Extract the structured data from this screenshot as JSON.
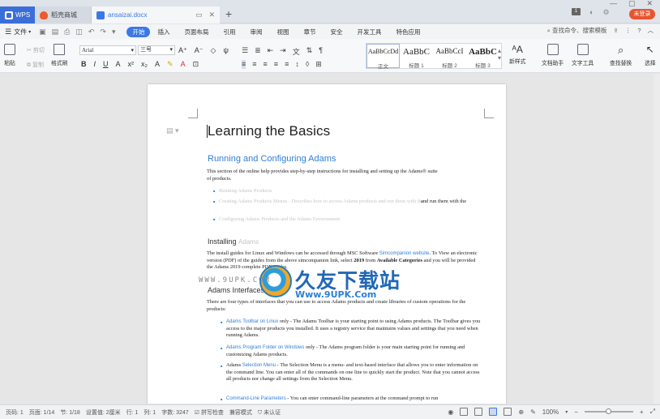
{
  "titlebar": {
    "app_tab": "WPS",
    "tabs": [
      {
        "label": "稻壳商城"
      },
      {
        "label": "ansaizai.docx"
      }
    ],
    "new_tab": "+",
    "login": "未登录"
  },
  "menubar": {
    "file": "文件",
    "tabs": [
      "开始",
      "插入",
      "页面布局",
      "引用",
      "审阅",
      "视图",
      "章节",
      "安全",
      "开发工具",
      "特色应用"
    ],
    "active_tab": "开始",
    "search": "查找命令、搜索模板"
  },
  "ribbon": {
    "paste": "粘贴",
    "cut": "剪切",
    "copy": "复制",
    "format_painter": "格式刷",
    "font_name": "Arial",
    "font_size": "三号",
    "styles": [
      {
        "sample": "AaBbCcDd",
        "name": "正文"
      },
      {
        "sample": "AaBbC",
        "name": "标题 1"
      },
      {
        "sample": "AaBbCcI",
        "name": "标题 2"
      },
      {
        "sample": "AaBbC",
        "name": "标题 3"
      }
    ],
    "new_style": "新样式",
    "doc_assistant": "文档助手",
    "text_tools": "文字工具",
    "find_replace": "查找替换",
    "select": "选择"
  },
  "document": {
    "title": "Learning the Basics",
    "heading2": "Running and Configuring  Adams",
    "p1_a": "This section of the online help provides step-by-step instructions for installing and setting up the Adams® suite",
    "p1_b": "of products.",
    "bullets_1": [
      "Running Adams Products",
      "Creating Adams Products Menus - Describes how to access Adams products and run them with the",
      "Configuring Adams Products and the Adams Environment"
    ],
    "b2_cont": "and run them with the",
    "installing_heading": "Installing",
    "installing_faint": "Adams",
    "installing_p": [
      "The install guides for Linux and Windows can be accessed through MSC Software ",
      "Simcompanion website",
      ". To View an electronic version (PDF) of the guides from the above simcompanion link, select ",
      "2019",
      " from ",
      "Available Categories",
      " and you will be provided the Adams 2019 complete PDF guides."
    ],
    "interfaces_heading": "Adams  Interfaces",
    "interfaces_p": "There are four types of interfaces that you can use to access Adams products and create libraries of custom operations for the products:",
    "interfaces_bullets": [
      {
        "link": "Adams Toolbar on Linux",
        "text": " only - The Adams Toolbar is your starting point to using Adams products. The Toolbar gives you access to the major products you installed. It uses a registry service that maintains values and settings that you need when running Adams."
      },
      {
        "link": "Adams Program Folder on Windows",
        "text": " only - The Adams program folder is your main starting point for running and customizing Adams products."
      },
      {
        "prefix": "Adams ",
        "link": "Selection Menu",
        "text": " - The Selection Menu is a menu- and text-based interface that allows you to enter information on the command line. You can enter all of the commands on one line to quickly start the product. Note that you cannot access all products nor change all settings from the Selection Menu."
      },
      {
        "link": "Command-Line Parameters",
        "text": " - You can enter command-line parameters at the command prompt to run"
      }
    ],
    "watermark_title": "久友下载站",
    "watermark_url": "Www.9UPK.Com",
    "watermark_url2": "WWW.9UPK.COM"
  },
  "statusbar": {
    "page": "页码: 1",
    "pages": "页面: 1/14",
    "section": "节: 1/18",
    "setting": "设置值: 2厘米",
    "row": "行: 1",
    "col": "列: 1",
    "words": "字数: 3247",
    "spell": "拼写检查",
    "compat": "兼容模式",
    "auth": "未认证",
    "zoom": "100%",
    "zoom_level": 0.5
  }
}
